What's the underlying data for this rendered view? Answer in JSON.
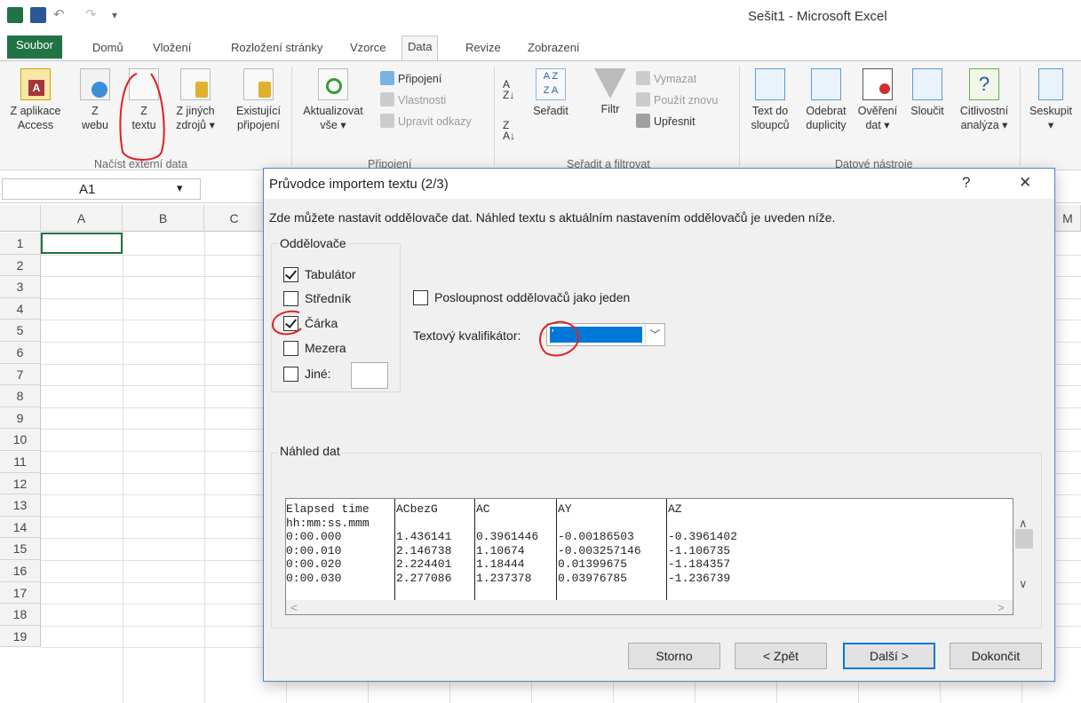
{
  "window": {
    "title": "Sešit1 - Microsoft Excel"
  },
  "tabs": [
    "Soubor",
    "Domů",
    "Vložení",
    "Rozložení stránky",
    "Vzorce",
    "Data",
    "Revize",
    "Zobrazení"
  ],
  "ribbon": {
    "get_external": {
      "access": [
        "Z aplikace",
        "Access"
      ],
      "web": [
        "Z",
        "webu"
      ],
      "text": [
        "Z",
        "textu"
      ],
      "other": [
        "Z jiných",
        "zdrojů ▾"
      ],
      "existing": [
        "Existující",
        "připojení"
      ],
      "group_label": "Načíst externí data"
    },
    "connections": {
      "refresh": [
        "Aktualizovat",
        "vše ▾"
      ],
      "conn": "Připojení",
      "props": "Vlastnosti",
      "edit_links": "Upravit odkazy",
      "group_label": "Připojení"
    },
    "sort_filter": {
      "sort": "Seřadit",
      "filter": "Filtr",
      "clear": "Vymazat",
      "reapply": "Použít znovu",
      "advanced": "Upřesnit",
      "group_label": "Seřadit a filtrovat"
    },
    "data_tools": {
      "text_to_cols": [
        "Text do",
        "sloupců"
      ],
      "remove_dup": [
        "Odebrat",
        "duplicity"
      ],
      "validation": [
        "Ověření",
        "dat ▾"
      ],
      "consolidate": [
        "Sloučit",
        ""
      ],
      "whatif": [
        "Citlivostní",
        "analýza ▾"
      ],
      "group_label": "Datové nástroje"
    },
    "outline": {
      "group": [
        "Seskupit",
        "▾"
      ]
    }
  },
  "formula_bar": {
    "name_box": "A1"
  },
  "grid": {
    "columns": [
      "A",
      "B",
      "C",
      "M"
    ],
    "rows": [
      "1",
      "2",
      "3",
      "4",
      "5",
      "6",
      "7",
      "8",
      "9",
      "10",
      "11",
      "12",
      "13",
      "14",
      "15",
      "16",
      "17",
      "18",
      "19"
    ]
  },
  "dialog": {
    "title": "Průvodce importem textu (2/3)",
    "help": "?",
    "close": "✕",
    "description": "Zde můžete nastavit oddělovače dat. Náhled textu s aktuálním nastavením oddělovačů je uveden níže.",
    "delimiters_legend": "Oddělovače",
    "delimiters": [
      {
        "label": "Tabulátor",
        "checked": true
      },
      {
        "label": "Středník",
        "checked": false
      },
      {
        "label": "Čárka",
        "checked": true
      },
      {
        "label": "Mezera",
        "checked": false
      },
      {
        "label": "Jiné:",
        "checked": false
      }
    ],
    "consecutive_label": "Posloupnost oddělovačů jako jeden",
    "qualifier_label": "Textový kvalifikátor:",
    "qualifier_value": "'",
    "preview_legend": "Náhled dat",
    "preview_columns": [
      {
        "lines": [
          "Elapsed time",
          "hh:mm:ss.mmm",
          "0:00.000",
          "0:00.010",
          "0:00.020",
          "0:00.030"
        ]
      },
      {
        "lines": [
          "ACbezG",
          "",
          "1.436141",
          "2.146738",
          "2.224401",
          "2.277086"
        ]
      },
      {
        "lines": [
          "AC",
          "",
          "0.3961446",
          "1.10674",
          "1.18444",
          "1.237378"
        ]
      },
      {
        "lines": [
          "AY",
          "",
          "-0.00186503",
          "-0.003257146",
          "0.01399675",
          "0.03976785"
        ]
      },
      {
        "lines": [
          "AZ",
          "",
          "-0.3961402",
          "-1.106735",
          "-1.184357",
          "-1.236739"
        ]
      }
    ],
    "buttons": {
      "cancel": "Storno",
      "back": "< Zpět",
      "next": "Další >",
      "finish": "Dokončit"
    }
  }
}
